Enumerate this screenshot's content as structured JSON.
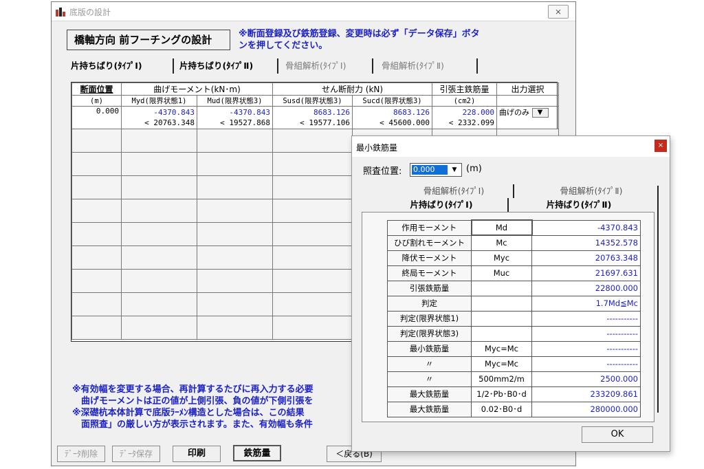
{
  "window": {
    "title": "底版の設計",
    "close_glyph": "⨯"
  },
  "header": {
    "label": "橋軸方向 前フーチングの設計",
    "note": "※断面登録及び鉄筋登録、変更時は必ず「データ保存」ボタンを押してください。"
  },
  "tabs": [
    {
      "label": "片持ちばり(ﾀｲﾌﾟⅠ)"
    },
    {
      "label": "片持ちばり(ﾀｲﾌﾟⅡ)"
    },
    {
      "label": "骨組解析(ﾀｲﾌﾟⅠ)"
    },
    {
      "label": "骨組解析(ﾀｲﾌﾟⅡ)"
    }
  ],
  "table": {
    "headers": [
      "断面位置",
      "曲げモーメント(kN･m)",
      "せん断耐力 (kN)",
      "引張主鉄筋量",
      "出力選択"
    ],
    "subheaders": [
      "(m)",
      "Myd(限界状態1)",
      "Mud(限界状態3)",
      "Susd(限界状態3)",
      "Sucd(限界状態3)",
      "(cm2)",
      ""
    ],
    "row1": {
      "pos": "0.000",
      "myd": "-4370.843",
      "mud": "-4370.843",
      "susd": "8683.126",
      "sucd": "8683.126",
      "as": "228.000",
      "output": "曲げのみ",
      "myd2": "< 20763.348",
      "mud2": "< 19527.868",
      "susd2": "< 19577.106",
      "sucd2": "< 45600.000",
      "as2": "<  2332.099"
    }
  },
  "notes_bottom": [
    "※有効幅を変更する場合、再計算するたびに再入力する必要",
    "　曲げモーメントは正の値が上側引張、負の値が下側引張を",
    "※深礎杭本体計算で底版ﾗｰﾒﾝ構造とした場合は、この結果",
    "　面照査」の厳しい方が表示されます。また、有効幅も条件"
  ],
  "buttons": {
    "delete": "ﾃﾞｰﾀ削除",
    "save": "ﾃﾞｰﾀ保存",
    "print": "印刷",
    "rebar": "鉄筋量",
    "back": "＜戻る(B)"
  },
  "dialog": {
    "title": "最小鉄筋量",
    "close_glyph": "×",
    "position_label": "照査位置:",
    "position_value": "0.000",
    "position_unit": "(m)",
    "tabs_back": [
      "骨組解析(ﾀｲﾌﾟⅠ)",
      "骨組解析(ﾀｲﾌﾟⅡ)"
    ],
    "tabs_front": [
      "片持ばり(ﾀｲﾌﾟⅠ)",
      "片持ばり(ﾀｲﾌﾟⅡ)"
    ],
    "rows": [
      {
        "label": "作用モーメント",
        "mid": "Md",
        "value": "-4370.843"
      },
      {
        "label": "ひび割れモーメント",
        "mid": "Mc",
        "value": "14352.578"
      },
      {
        "label": "降伏モーメント",
        "mid": "Myc",
        "value": "20763.348"
      },
      {
        "label": "終局モーメント",
        "mid": "Muc",
        "value": "21697.631"
      },
      {
        "label": "引張鉄筋量",
        "mid": "",
        "value": "22800.000"
      },
      {
        "label": "判定",
        "mid": "",
        "value": "1.7Md≦Mc"
      },
      {
        "label": "判定(限界状態1)",
        "mid": "",
        "value": "-----------"
      },
      {
        "label": "判定(限界状態3)",
        "mid": "",
        "value": "-----------"
      },
      {
        "label": "最小鉄筋量",
        "mid": "Myc=Mc",
        "value": "-----------"
      },
      {
        "label": "〃",
        "mid": "Myc=Mc",
        "value": "-----------"
      },
      {
        "label": "〃",
        "mid": "500mm2/m",
        "value": "2500.000"
      },
      {
        "label": "最大鉄筋量",
        "mid": "1/2･Pb･B0･d",
        "value": "233209.861"
      },
      {
        "label": "最大鉄筋量",
        "mid": "0.02･B0･d",
        "value": "280000.000"
      }
    ],
    "ok_label": "OK"
  }
}
